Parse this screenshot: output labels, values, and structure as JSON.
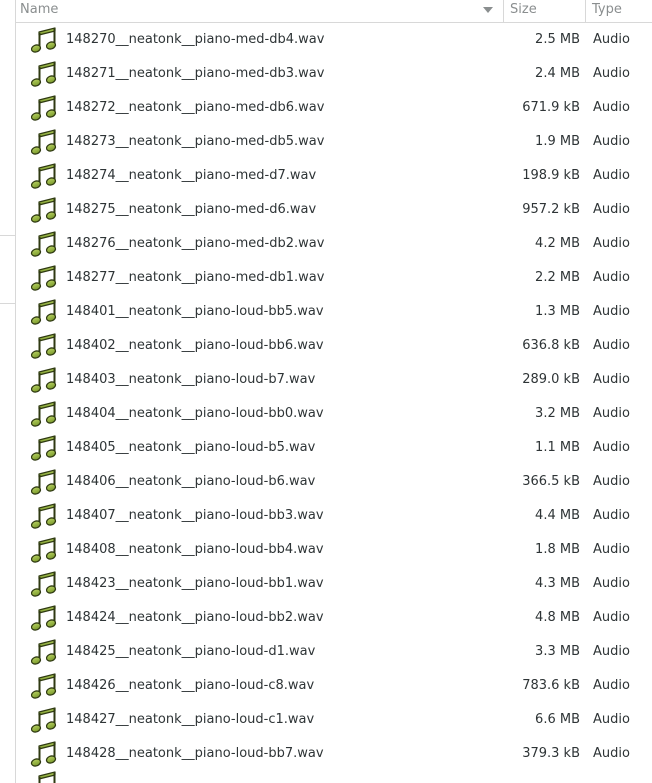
{
  "columns": {
    "name": "Name",
    "size": "Size",
    "type": "Type"
  },
  "icon": "audio-file-icon",
  "accent": "#8ba83a",
  "files": [
    {
      "name": "148270__neatonk__piano-med-db4.wav",
      "size": "2.5 MB",
      "type": "Audio"
    },
    {
      "name": "148271__neatonk__piano-med-db3.wav",
      "size": "2.4 MB",
      "type": "Audio"
    },
    {
      "name": "148272__neatonk__piano-med-db6.wav",
      "size": "671.9 kB",
      "type": "Audio"
    },
    {
      "name": "148273__neatonk__piano-med-db5.wav",
      "size": "1.9 MB",
      "type": "Audio"
    },
    {
      "name": "148274__neatonk__piano-med-d7.wav",
      "size": "198.9 kB",
      "type": "Audio"
    },
    {
      "name": "148275__neatonk__piano-med-d6.wav",
      "size": "957.2 kB",
      "type": "Audio"
    },
    {
      "name": "148276__neatonk__piano-med-db2.wav",
      "size": "4.2 MB",
      "type": "Audio"
    },
    {
      "name": "148277__neatonk__piano-med-db1.wav",
      "size": "2.2 MB",
      "type": "Audio"
    },
    {
      "name": "148401__neatonk__piano-loud-bb5.wav",
      "size": "1.3 MB",
      "type": "Audio"
    },
    {
      "name": "148402__neatonk__piano-loud-bb6.wav",
      "size": "636.8 kB",
      "type": "Audio"
    },
    {
      "name": "148403__neatonk__piano-loud-b7.wav",
      "size": "289.0 kB",
      "type": "Audio"
    },
    {
      "name": "148404__neatonk__piano-loud-bb0.wav",
      "size": "3.2 MB",
      "type": "Audio"
    },
    {
      "name": "148405__neatonk__piano-loud-b5.wav",
      "size": "1.1 MB",
      "type": "Audio"
    },
    {
      "name": "148406__neatonk__piano-loud-b6.wav",
      "size": "366.5 kB",
      "type": "Audio"
    },
    {
      "name": "148407__neatonk__piano-loud-bb3.wav",
      "size": "4.4 MB",
      "type": "Audio"
    },
    {
      "name": "148408__neatonk__piano-loud-bb4.wav",
      "size": "1.8 MB",
      "type": "Audio"
    },
    {
      "name": "148423__neatonk__piano-loud-bb1.wav",
      "size": "4.3 MB",
      "type": "Audio"
    },
    {
      "name": "148424__neatonk__piano-loud-bb2.wav",
      "size": "4.8 MB",
      "type": "Audio"
    },
    {
      "name": "148425__neatonk__piano-loud-d1.wav",
      "size": "3.3 MB",
      "type": "Audio"
    },
    {
      "name": "148426__neatonk__piano-loud-c8.wav",
      "size": "783.6 kB",
      "type": "Audio"
    },
    {
      "name": "148427__neatonk__piano-loud-c1.wav",
      "size": "6.6 MB",
      "type": "Audio"
    },
    {
      "name": "148428__neatonk__piano-loud-bb7.wav",
      "size": "379.3 kB",
      "type": "Audio"
    }
  ]
}
